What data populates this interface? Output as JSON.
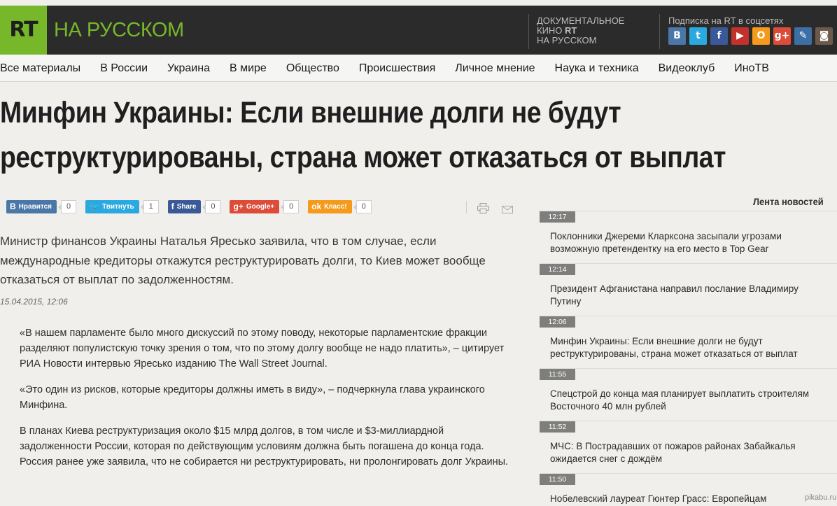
{
  "header": {
    "logo_mark": "RT",
    "logo_text": "НА РУССКОМ",
    "doc_line1": "ДОКУМЕНТАЛЬНОЕ",
    "doc_line2_pre": "КИНО ",
    "doc_line2_mark": "RT",
    "doc_line3": "НА РУССКОМ",
    "social_caption": "Подписка на RT в соцсетях",
    "social": [
      {
        "icon": "vk-icon",
        "glyph": "В",
        "color": "#4a76a8"
      },
      {
        "icon": "twitter-icon",
        "glyph": "t",
        "color": "#2aa9e0"
      },
      {
        "icon": "facebook-icon",
        "glyph": "f",
        "color": "#3b5998"
      },
      {
        "icon": "youtube-icon",
        "glyph": "▶",
        "color": "#c4302b"
      },
      {
        "icon": "odnoklassniki-icon",
        "glyph": "О",
        "color": "#f59a1b"
      },
      {
        "icon": "googleplus-icon",
        "glyph": "g+",
        "color": "#dd4b39"
      },
      {
        "icon": "livejournal-icon",
        "glyph": "✎",
        "color": "#3d6fa5"
      },
      {
        "icon": "instagram-icon",
        "glyph": "◙",
        "color": "#6b5a4a"
      }
    ]
  },
  "nav": {
    "items": [
      "Все материалы",
      "В России",
      "Украина",
      "В мире",
      "Общество",
      "Происшествия",
      "Личное мнение",
      "Наука и техника",
      "Видеоклуб",
      "ИноТВ"
    ]
  },
  "article": {
    "title": "Минфин Украины: Если внешние долги не будут реструктурированы, страна может отказаться от выплат",
    "lead": "Министр финансов Украины Наталья Яресько заявила, что в том случае, если международные кредиторы откажутся реструктурировать долги, то Киев может вообще отказаться от выплат по задолженностям.",
    "date": "15.04.2015, 12:06",
    "paragraphs": [
      "«В нашем парламенте было много дискуссий по этому поводу, некоторые парламентские фракции разделяют популистскую точку зрения о том, что по этому долгу вообще не надо платить», – цитирует РИА Новости интервью Яресько изданию The Wall Street Journal.",
      "«Это один из рисков, которые кредиторы должны иметь в виду», – подчеркнула глава украинского Минфина.",
      "В планах Киева реструктуризация около $15 млрд долгов, в том числе и $3-миллиардной задолженности России, которая по действующим условиям должна быть погашена до конца года. Россия ранее уже заявила, что не собирается ни реструктурировать, ни пролонгировать долг Украины."
    ]
  },
  "share": [
    {
      "name": "vk-like-button",
      "icon": "vk-icon",
      "glyph": "В",
      "label": "Нравится",
      "count": "0",
      "color": "#4a76a8"
    },
    {
      "name": "tweet-button",
      "icon": "twitter-bird-icon",
      "glyph": "🐦",
      "label": "Твитнуть",
      "count": "1",
      "color": "#2aa9e0"
    },
    {
      "name": "fb-share-button",
      "icon": "facebook-icon",
      "glyph": "f",
      "label": "Share",
      "count": "0",
      "color": "#3b5998"
    },
    {
      "name": "googleplus-button",
      "icon": "googleplus-icon",
      "glyph": "g+",
      "label": "Google+",
      "count": "0",
      "color": "#dd4b39"
    },
    {
      "name": "ok-class-button",
      "icon": "odnoklassniki-icon",
      "glyph": "ok",
      "label": "Класс!",
      "count": "0",
      "color": "#f59a1b"
    }
  ],
  "feed": {
    "title": "Лента новостей",
    "items": [
      {
        "time": "12:17",
        "text": "Поклонники Джереми Кларксона засыпали угрозами возможную претендентку на его место в Top Gear"
      },
      {
        "time": "12:14",
        "text": "Президент Афганистана направил послание Владимиру Путину"
      },
      {
        "time": "12:06",
        "text": "Минфин Украины: Если внешние долги не будут реструктурированы, страна может отказаться от выплат"
      },
      {
        "time": "11:55",
        "text": "Спецстрой до конца мая планирует выплатить строителям Восточного 40 млн рублей"
      },
      {
        "time": "11:52",
        "text": "МЧС: В Пострадавших от пожаров районах Забайкалья ожидается снег с дождём"
      },
      {
        "time": "11:50",
        "text": "Нобелевский лауреат Гюнтер Грасс: Европейцам"
      }
    ]
  },
  "watermark": "pikabu.ru"
}
